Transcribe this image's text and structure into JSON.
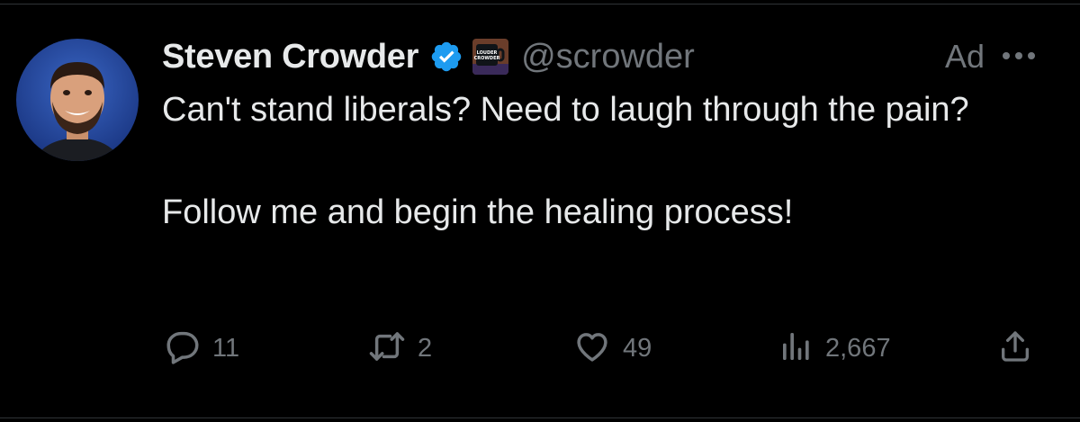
{
  "tweet": {
    "display_name": "Steven Crowder",
    "handle": "@scrowder",
    "ad_label": "Ad",
    "text_line1": "Can't stand liberals? Need to laugh through the pain?",
    "text_line2": "Follow me and begin the healing process!",
    "affiliation_badge_text": [
      "LOUDER",
      "CROWDER"
    ],
    "icons": {
      "verified": "verified-badge-icon",
      "more": "more-options-icon",
      "reply": "reply-icon",
      "repost": "repost-icon",
      "like": "like-icon",
      "views": "views-icon",
      "share": "share-icon"
    },
    "counts": {
      "replies": "11",
      "reposts": "2",
      "likes": "49",
      "views": "2,667"
    },
    "colors": {
      "background": "#000000",
      "text": "#e7e9ea",
      "muted": "#71767b",
      "verified_blue": "#1d9bf0"
    }
  }
}
